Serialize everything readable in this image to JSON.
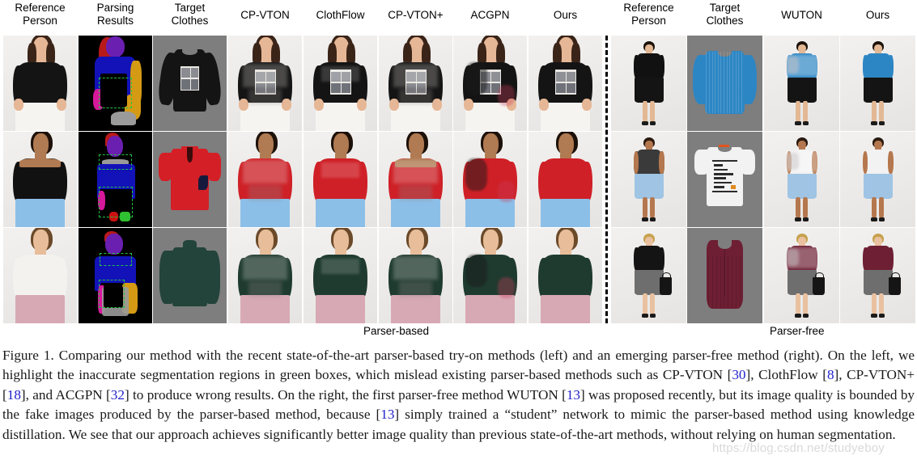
{
  "figure": {
    "left_section_label": "Parser-based",
    "right_section_label": "Parser-free",
    "watermark": "https://blog.csdn.net/studyeboy"
  },
  "left_columns": [
    {
      "id": "reference-person",
      "line1": "Reference",
      "line2": "Person"
    },
    {
      "id": "parsing-results",
      "line1": "Parsing",
      "line2": "Results"
    },
    {
      "id": "target-clothes",
      "line1": "Target",
      "line2": "Clothes"
    },
    {
      "id": "cp-vton",
      "line1": "CP-VTON",
      "line2": ""
    },
    {
      "id": "clothflow",
      "line1": "ClothFlow",
      "line2": ""
    },
    {
      "id": "cp-vton-plus",
      "line1": "CP-VTON+",
      "line2": ""
    },
    {
      "id": "acgpn",
      "line1": "ACGPN",
      "line2": ""
    },
    {
      "id": "ours-left",
      "line1": "Ours",
      "line2": ""
    }
  ],
  "right_columns": [
    {
      "id": "reference-person",
      "line1": "Reference",
      "line2": "Person"
    },
    {
      "id": "target-clothes",
      "line1": "Target",
      "line2": "Clothes"
    },
    {
      "id": "wuton",
      "line1": "WUTON",
      "line2": ""
    },
    {
      "id": "ours-right",
      "line1": "Ours",
      "line2": ""
    }
  ],
  "caption": {
    "parts": [
      {
        "t": "Figure 1. Comparing our method with the recent state-of-the-art parser-based try-on methods (left) and an emerging parser-free method (right). On the left, we highlight the inaccurate segmentation regions in green boxes, which mislead existing parser-based methods such as CP-VTON ["
      },
      {
        "t": "30",
        "ref": true
      },
      {
        "t": "], ClothFlow ["
      },
      {
        "t": "8",
        "ref": true
      },
      {
        "t": "], CP-VTON+ ["
      },
      {
        "t": "18",
        "ref": true
      },
      {
        "t": "], and ACGPN ["
      },
      {
        "t": "32",
        "ref": true
      },
      {
        "t": "] to produce wrong results. On the right, the first parser-free method WUTON ["
      },
      {
        "t": "13",
        "ref": true
      },
      {
        "t": "] was proposed recently, but its image quality is bounded by the fake images produced by the parser-based method, because ["
      },
      {
        "t": "13",
        "ref": true
      },
      {
        "t": "] simply trained a “student” network to mimic the parser-based method using knowledge distillation. We see that our approach achieves significantly better image quality than previous state-of-the-art methods, without relying on human segmentation."
      }
    ]
  },
  "colors": {
    "reference_blue": "#2222cc",
    "highlight_box_green": "#22c243",
    "parse_hair_red": "#b81a1a",
    "parse_face_purple": "#6a1fb0",
    "parse_top_blue": "#1212b8",
    "parse_arm_orange": "#d49a14",
    "parse_hand_magenta": "#d6189a",
    "parse_skin_gray": "#9a9a9a",
    "parse_bg_black": "#000000",
    "studio_gray": "#7e7e7e",
    "divider": "#000000"
  },
  "grid": {
    "rows": 3,
    "left_cols": 8,
    "right_cols": 4,
    "row_subjects": [
      {
        "id": "row-1",
        "garment": "black-graphic-long-sleeve-tee",
        "person": "brunette-sheer-top-white-shorts"
      },
      {
        "id": "row-2",
        "garment": "red-polo-shirt",
        "person": "off-shoulder-black-top-blue-skirt"
      },
      {
        "id": "row-3",
        "garment": "dark-green-turtleneck",
        "person": "white-top-pink-floral-skirt"
      }
    ],
    "right_row_subjects": [
      {
        "id": "row-1",
        "garment": "blue-pleated-blouse",
        "person": "black-dress-pleated-skirt"
      },
      {
        "id": "row-2",
        "garment": "white-graphic-tee",
        "person": "floral-cami-blue-jeans"
      },
      {
        "id": "row-3",
        "garment": "burgundy-sleeveless-top",
        "person": "black-top-gray-skirt-handbag"
      }
    ]
  }
}
